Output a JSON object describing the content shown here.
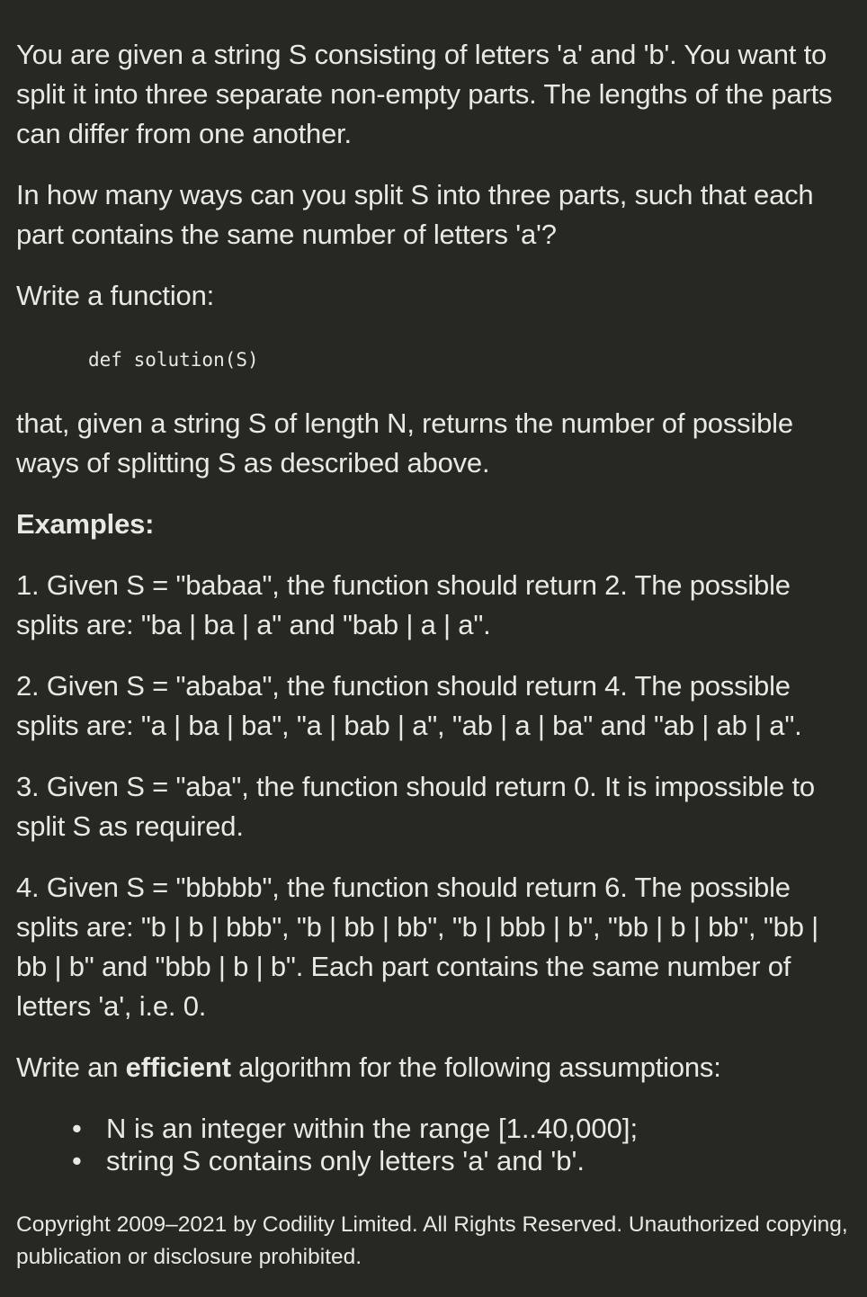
{
  "intro": "You are given a string S consisting of letters 'a' and 'b'. You want to split it into three separate non-empty parts. The lengths of the parts can differ from one another.",
  "question": "In how many ways can you split S into three parts, such that each part contains the same number of letters 'a'?",
  "write_function": "Write a function:",
  "signature": "def solution(S)",
  "description": "that, given a string S of length N, returns the number of possible ways of splitting S as described above.",
  "examples_heading": "Examples:",
  "examples": [
    "1. Given S = \"babaa\", the function should return 2. The possible splits are: \"ba | ba | a\" and \"bab | a | a\".",
    "2. Given S = \"ababa\", the function should return 4. The possible splits are: \"a | ba | ba\", \"a | bab | a\", \"ab | a | ba\" and \"ab | ab | a\".",
    "3. Given S = \"aba\", the function should return 0. It is impossible to split S as required.",
    "4. Given S = \"bbbbb\", the function should return 6. The possible splits are: \"b | b | bbb\", \"b | bb | bb\", \"b | bbb | b\", \"bb | b | bb\", \"bb | bb | b\" and \"bbb | b | b\". Each part contains the same number of letters 'a', i.e. 0."
  ],
  "efficient": {
    "before": "Write an ",
    "bold": "efficient",
    "after": " algorithm for the following assumptions:"
  },
  "assumptions": [
    "N is an integer within the range [1..40,000];",
    "string S contains only letters 'a' and 'b'."
  ],
  "bullet": "•",
  "copyright": "Copyright 2009–2021 by Codility Limited. All Rights Reserved. Unauthorized copying, publication or disclosure prohibited."
}
